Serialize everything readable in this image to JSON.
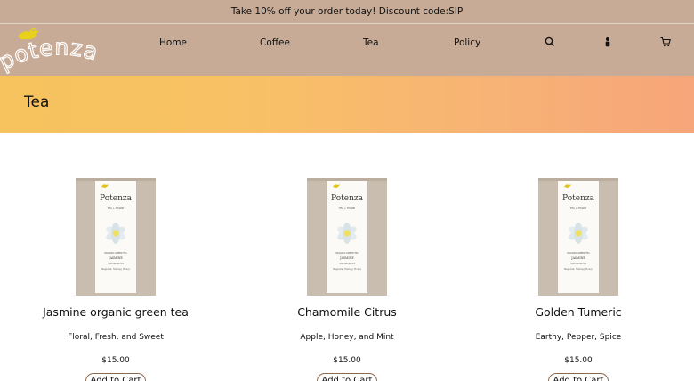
{
  "announcement": "Take 10% off your order today! Discount code:SIP",
  "brand": {
    "logo_text": "potenza"
  },
  "nav": {
    "items": [
      {
        "label": "Home"
      },
      {
        "label": "Coffee"
      },
      {
        "label": "Tea"
      },
      {
        "label": "Policy"
      }
    ],
    "icons": [
      "search-icon",
      "account-icon",
      "cart-icon"
    ]
  },
  "hero": {
    "title": "Tea"
  },
  "products": [
    {
      "name": "Jasmine organic green tea",
      "description": "Floral, Fresh, and Sweet",
      "price": "$15.00",
      "button": "Add to Cart",
      "package": {
        "brand": "Potenza",
        "line": "TEA + TISANE",
        "type": "ORGANIC GREEN TEA",
        "flavor": "JASMINE",
        "notes_title": "TASTING NOTES",
        "notes": "Magnolia, Nutmeg, Honey"
      }
    },
    {
      "name": "Chamomile Citrus",
      "description": "Apple, Honey, and Mint",
      "price": "$15.00",
      "button": "Add to Cart",
      "package": {
        "brand": "Potenza",
        "line": "TEA + TISANE",
        "type": "ORGANIC GREEN TEA",
        "flavor": "JASMINE",
        "notes_title": "TASTING NOTES",
        "notes": "Magnolia, Nutmeg, Honey"
      }
    },
    {
      "name": "Golden Tumeric",
      "description": "Earthy, Pepper, Spice",
      "price": "$15.00",
      "button": "Add to Cart",
      "package": {
        "brand": "Potenza",
        "line": "TEA + TISANE",
        "type": "ORGANIC GREEN TEA",
        "flavor": "JASMINE",
        "notes_title": "TASTING NOTES",
        "notes": "Magnolia, Nutmeg, Honey"
      }
    }
  ],
  "colors": {
    "header_bg": "#c7ab96",
    "hero_gradient_start": "#f6c35e",
    "hero_gradient_end": "#f7a57a",
    "logo_bird": "#e8d11a",
    "button_border": "#8b6a52"
  }
}
